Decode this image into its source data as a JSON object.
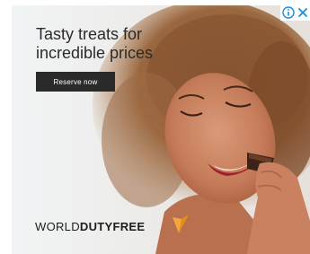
{
  "ad": {
    "headline_line1": "Tasty treats for",
    "headline_line2": "incredible prices",
    "cta_label": "Reserve now",
    "brand_part1": "WORLD",
    "brand_part2": "DUTYFREE",
    "colors": {
      "cta_bg": "#2a2a2a",
      "brand_mark": "#f2a93b",
      "adchoices": "#1a8fd8"
    }
  },
  "adchoices": {
    "info_icon": "info-icon",
    "close_icon": "close-icon"
  }
}
